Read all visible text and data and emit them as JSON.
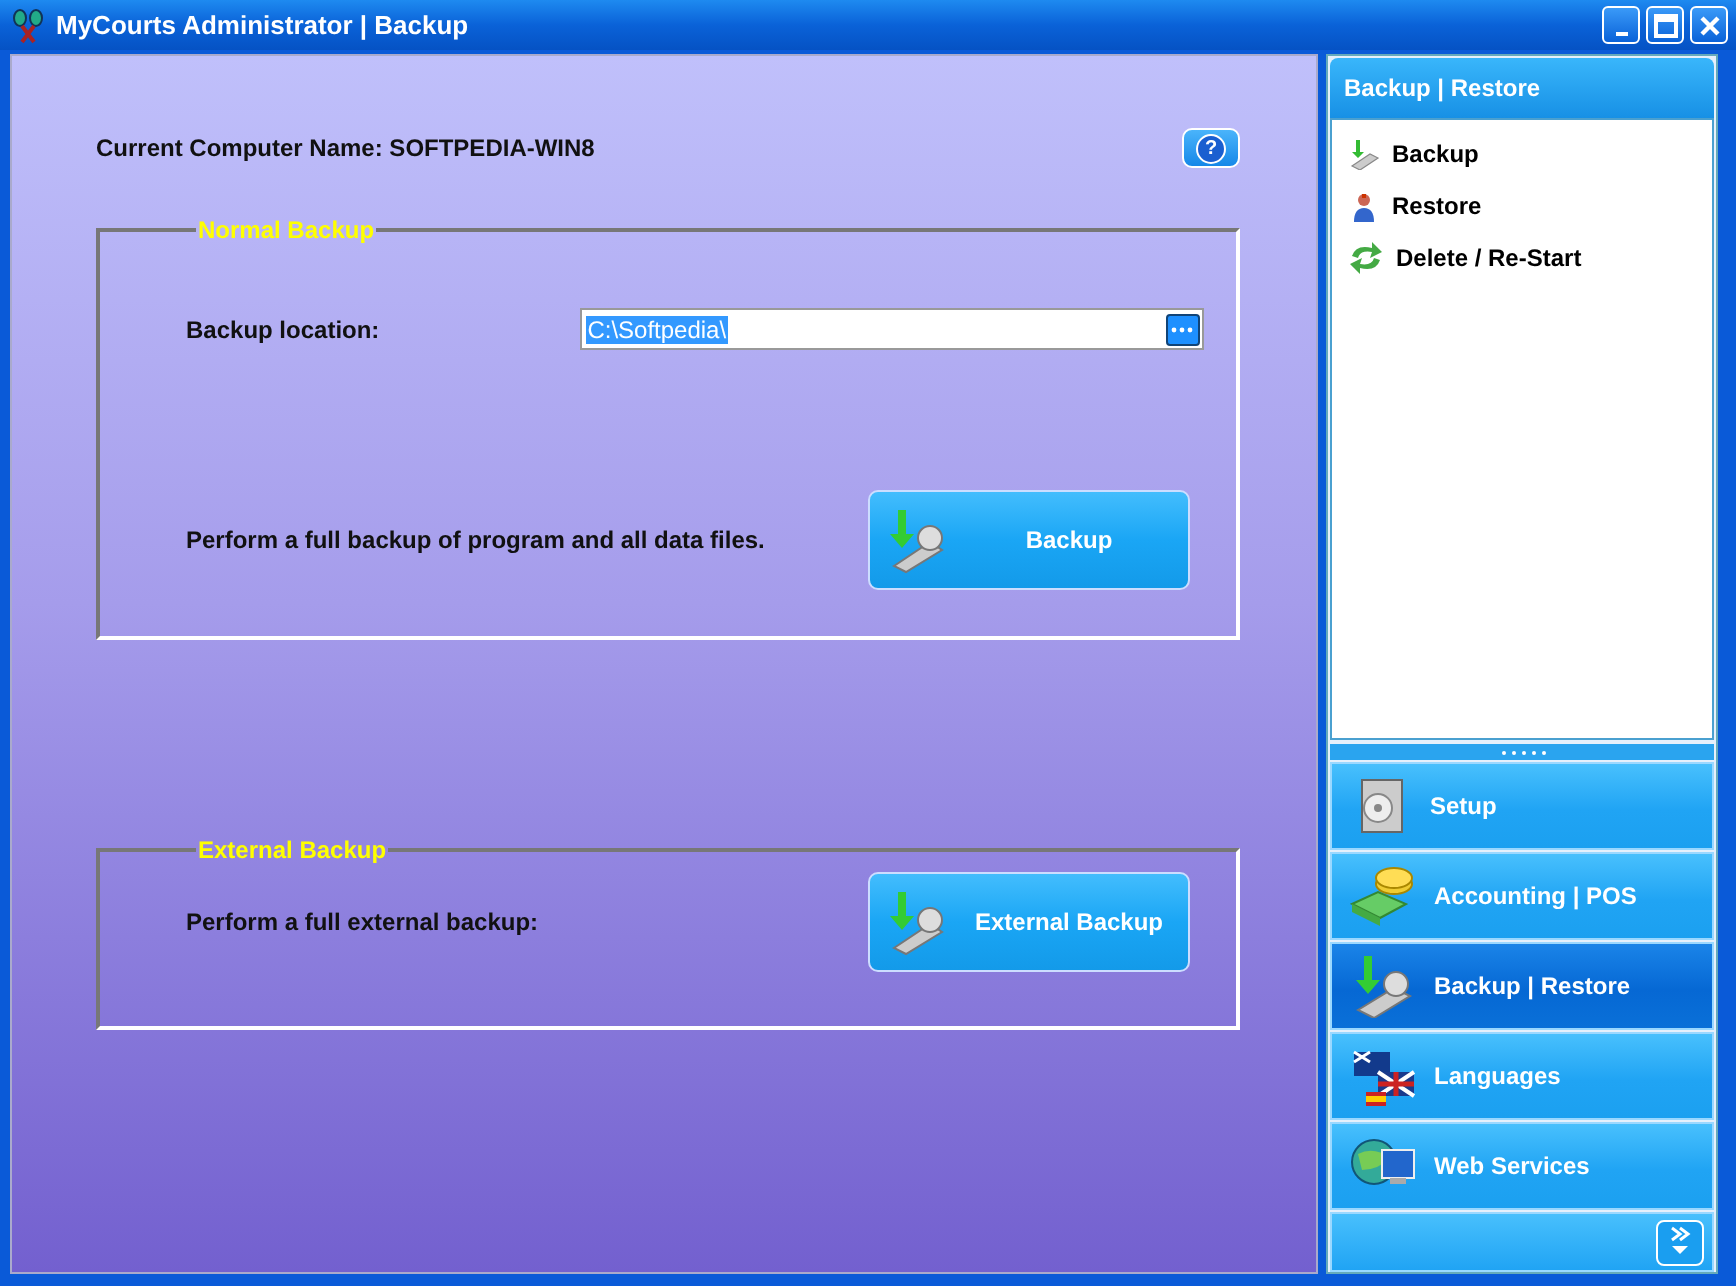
{
  "window": {
    "title": "MyCourts Administrator | Backup"
  },
  "computer_name": "Current Computer Name: SOFTPEDIA-WIN8",
  "help_button": "?",
  "normal_backup": {
    "legend": "Normal Backup",
    "location_label": "Backup location:",
    "location_value": "C:\\Softpedia\\",
    "description": "Perform a full backup of program and all data files.",
    "button": "Backup"
  },
  "external_backup": {
    "legend": "External Backup",
    "description": "Perform a full external backup:",
    "button": "External Backup"
  },
  "sidebar": {
    "header": "Backup | Restore",
    "items": [
      {
        "label": "Backup",
        "kind": "backup"
      },
      {
        "label": "Restore",
        "kind": "restore"
      },
      {
        "label": "Delete / Re-Start",
        "kind": "refresh"
      }
    ]
  },
  "nav": [
    {
      "label": "Setup",
      "kind": "setup",
      "selected": false
    },
    {
      "label": "Accounting | POS",
      "kind": "accounting",
      "selected": false
    },
    {
      "label": "Backup | Restore",
      "kind": "backup",
      "selected": true
    },
    {
      "label": "Languages",
      "kind": "languages",
      "selected": false
    },
    {
      "label": "Web Services",
      "kind": "web",
      "selected": false
    }
  ]
}
